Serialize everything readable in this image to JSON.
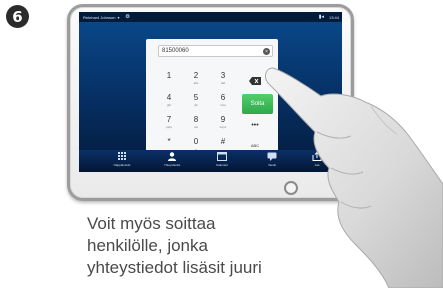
{
  "step_number": "6",
  "device": {
    "status_bar": {
      "user": "Reinhard Johnson",
      "time": "13:44"
    },
    "dialpad": {
      "number": "81500060",
      "keys": [
        {
          "digit": "1",
          "letters": ""
        },
        {
          "digit": "2",
          "letters": "abc"
        },
        {
          "digit": "3",
          "letters": "def"
        },
        {
          "digit": "4",
          "letters": "ghi"
        },
        {
          "digit": "5",
          "letters": "jkl"
        },
        {
          "digit": "6",
          "letters": "mno"
        },
        {
          "digit": "7",
          "letters": "pqrs"
        },
        {
          "digit": "8",
          "letters": "tuv"
        },
        {
          "digit": "9",
          "letters": "wxyz"
        },
        {
          "digit": "*",
          "letters": ""
        },
        {
          "digit": "0",
          "letters": "+"
        },
        {
          "digit": "#",
          "letters": ""
        }
      ],
      "call_label": "Soita",
      "more_label": "•••",
      "keyboard_label": "ABC"
    },
    "tray": [
      {
        "label": "Näppäimistö",
        "icon": "keypad-icon"
      },
      {
        "label": "Yhteystiedot",
        "icon": "contacts-icon"
      },
      {
        "label": "Kalenteri",
        "icon": "calendar-icon"
      },
      {
        "label": "Viestit",
        "icon": "messages-icon"
      },
      {
        "label": "Jaa",
        "icon": "share-icon"
      }
    ]
  },
  "caption": {
    "line1": "Voit myös soittaa",
    "line2": "henkilölle, jonka",
    "line3": "yhteystiedot lisäsit juuri"
  },
  "colors": {
    "screen_top": "#0a4a8c",
    "call_green": "#3cbf5a",
    "caption_text": "#4a4a4a"
  }
}
